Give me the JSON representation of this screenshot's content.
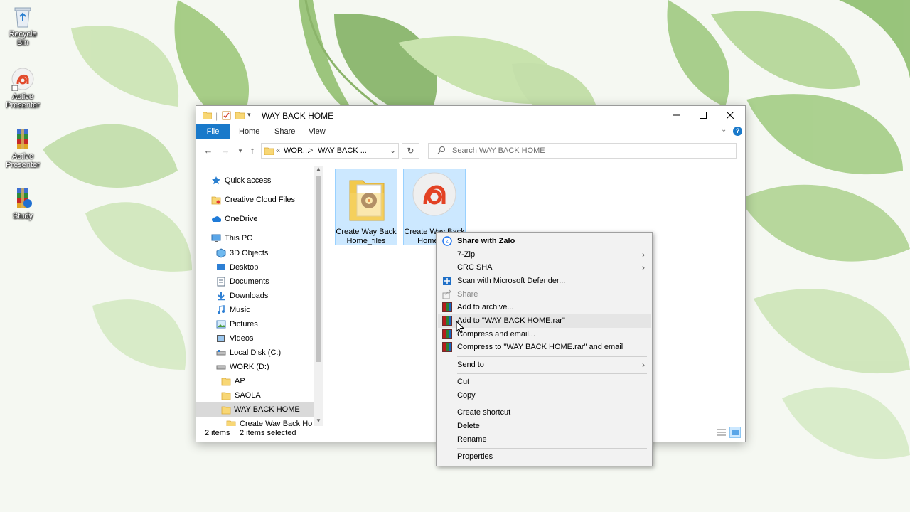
{
  "desktop": {
    "icons": [
      {
        "label": "Recycle Bin",
        "icon": "recycle-bin-icon"
      },
      {
        "label": "Active Presenter",
        "icon": "active-presenter-icon"
      },
      {
        "label": "Active Presenter",
        "icon": "winrar-archive-icon"
      },
      {
        "label": "Study",
        "icon": "winrar-archive-icon"
      }
    ]
  },
  "explorer": {
    "title": "WAY BACK HOME",
    "ribbon_tabs": [
      "File",
      "Home",
      "Share",
      "View"
    ],
    "address": {
      "root": "«",
      "segment1": "WOR...",
      "separator": ">",
      "segment2": "WAY BACK ..."
    },
    "search_placeholder": "Search WAY BACK HOME",
    "nav": {
      "quick_access": "Quick access",
      "creative_cloud": "Creative Cloud Files",
      "onedrive": "OneDrive",
      "this_pc": "This PC",
      "objects_3d": "3D Objects",
      "desktop": "Desktop",
      "documents": "Documents",
      "downloads": "Downloads",
      "music": "Music",
      "pictures": "Pictures",
      "videos": "Videos",
      "local_disk": "Local Disk (C:)",
      "work_drive": "WORK (D:)",
      "folder_ap": "AP",
      "folder_saola": "SAOLA",
      "folder_way_back_home": "WAY BACK HOME",
      "folder_partial": "Create Way Back Home"
    },
    "files": [
      {
        "name_line1": "Create Way Back",
        "name_line2": "Home_files",
        "icon": "folder-icon"
      },
      {
        "name_line1": "Create Way Back",
        "name_line2": "Home.a...",
        "icon": "active-presenter-icon"
      }
    ],
    "status": {
      "items": "2 items",
      "selected": "2 items selected"
    }
  },
  "context_menu": {
    "items": [
      {
        "label": "Share with Zalo",
        "bold": true,
        "icon": "zalo-icon"
      },
      {
        "label": "7-Zip",
        "submenu": true
      },
      {
        "label": "CRC SHA",
        "submenu": true
      },
      {
        "label": "Scan with Microsoft Defender...",
        "icon": "defender-icon"
      },
      {
        "label": "Share",
        "disabled": true,
        "icon": "share-icon"
      },
      {
        "label": "Add to archive...",
        "icon": "winrar-icon"
      },
      {
        "label": "Add to \"WAY BACK HOME.rar\"",
        "icon": "winrar-icon",
        "hover": true
      },
      {
        "label": "Compress and email...",
        "icon": "winrar-icon"
      },
      {
        "label": "Compress to \"WAY BACK HOME.rar\" and email",
        "icon": "winrar-icon"
      },
      {
        "label": "Send to",
        "submenu": true
      },
      {
        "label": "Cut"
      },
      {
        "label": "Copy"
      },
      {
        "label": "Create shortcut"
      },
      {
        "label": "Delete"
      },
      {
        "label": "Rename"
      },
      {
        "label": "Properties"
      }
    ]
  },
  "colors": {
    "accent": "#1979ca",
    "selection": "#cce8ff",
    "menu_bg": "#f2f2f2"
  }
}
